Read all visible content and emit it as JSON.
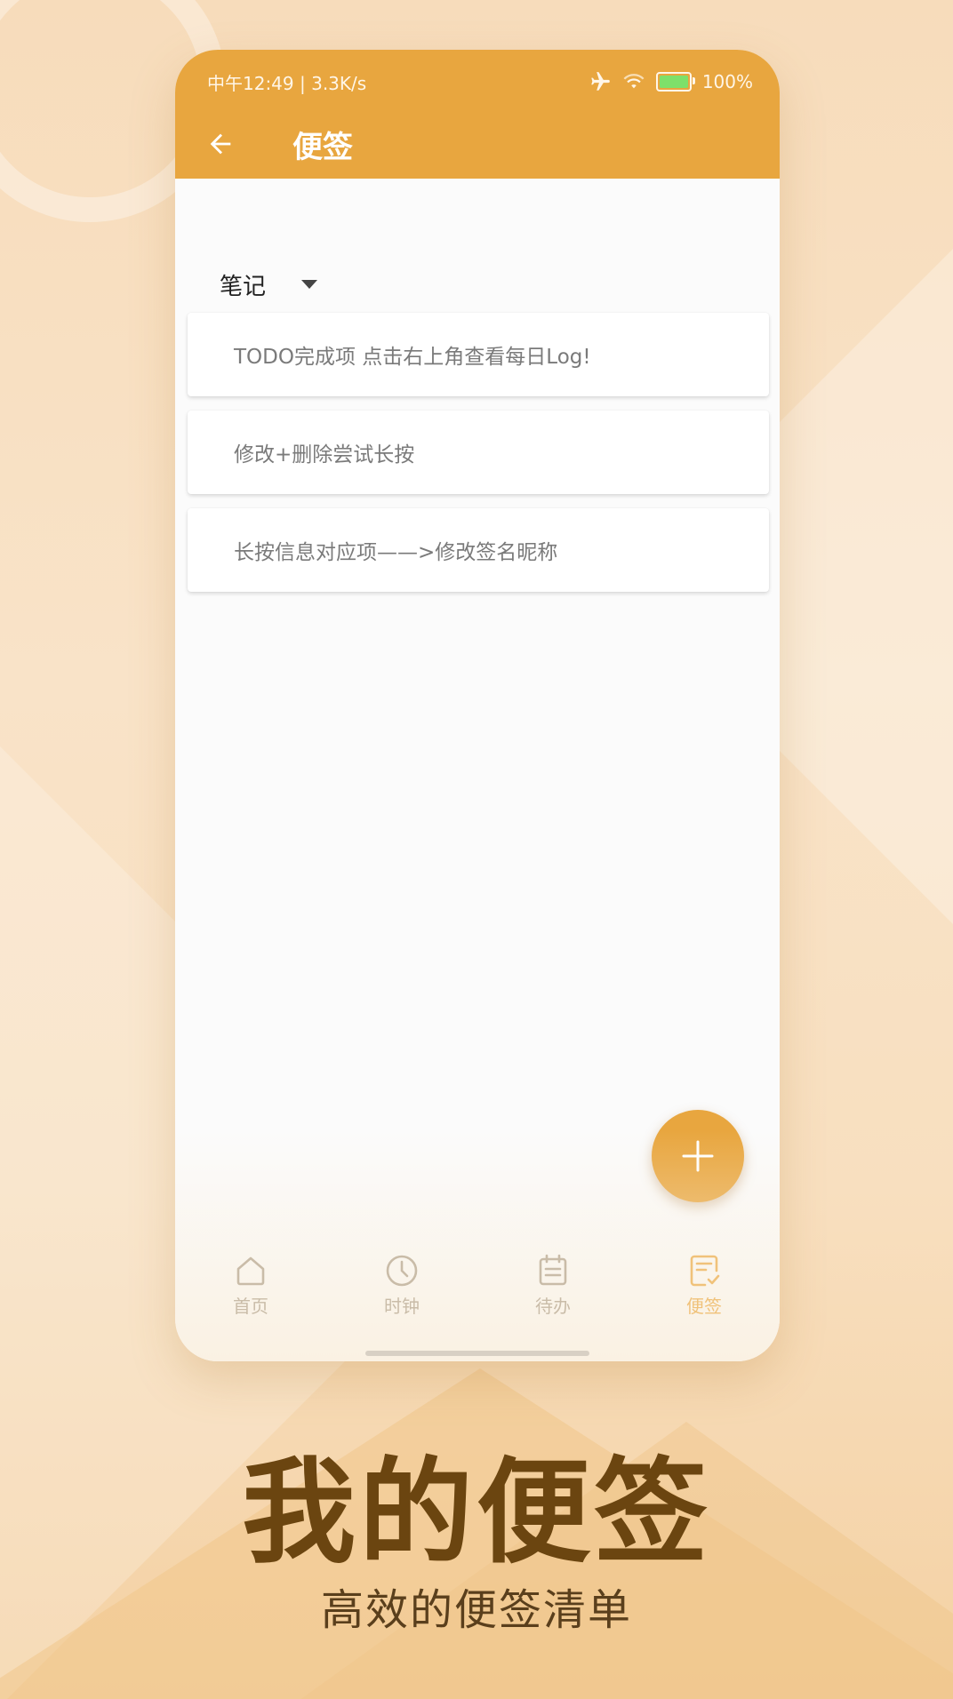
{
  "status_bar": {
    "time_speed": "中午12:49 | 3.3K/s",
    "battery": "100%"
  },
  "header": {
    "title": "便签"
  },
  "category": {
    "selected": "笔记"
  },
  "notes": [
    {
      "text": "TODO完成项 点击右上角查看每日Log!"
    },
    {
      "text": "修改+删除尝试长按"
    },
    {
      "text": "长按信息对应项——>修改签名昵称"
    }
  ],
  "bottom_nav": {
    "items": [
      {
        "label": "首页",
        "icon": "home-icon"
      },
      {
        "label": "时钟",
        "icon": "clock-icon"
      },
      {
        "label": "待办",
        "icon": "calendar-icon"
      },
      {
        "label": "便签",
        "icon": "note-icon"
      }
    ],
    "active": "便签"
  },
  "marketing": {
    "headline": "我的便签",
    "subline": "高效的便签清单"
  },
  "colors": {
    "accent": "#e8a63f",
    "headline": "#6b4510",
    "active_nav": "#f0c27a"
  }
}
